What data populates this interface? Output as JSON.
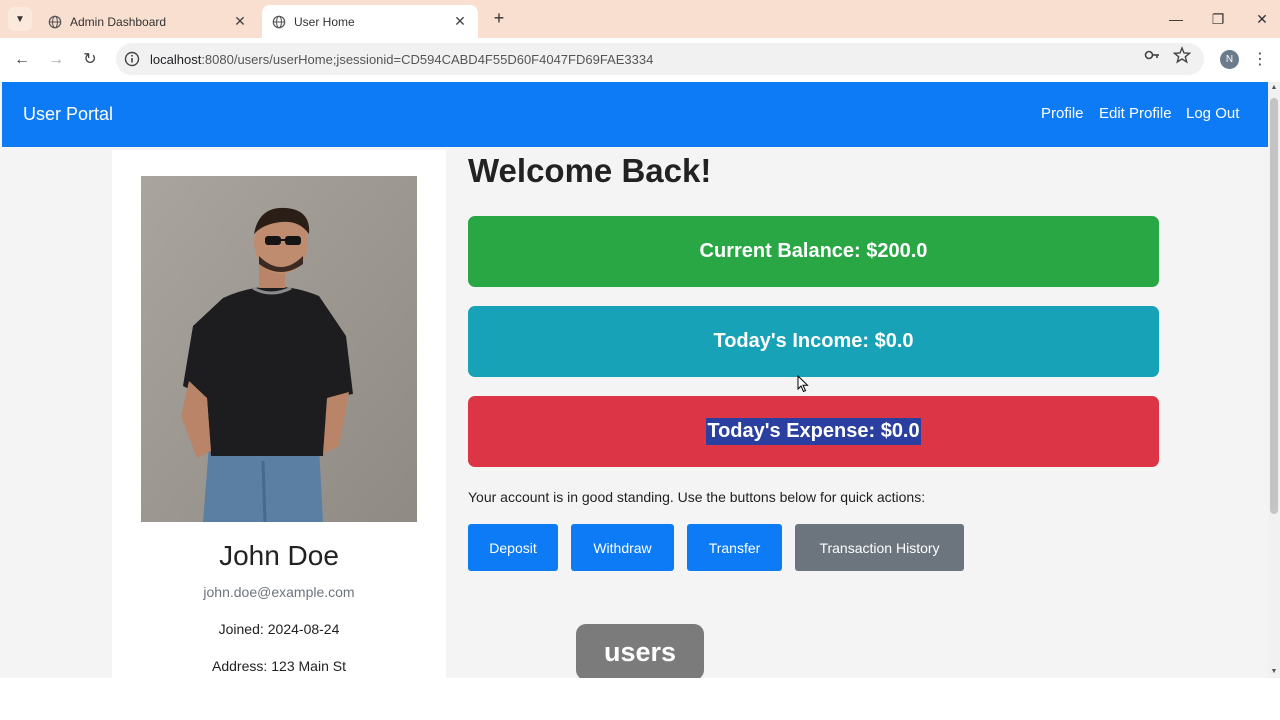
{
  "browser": {
    "tabs": [
      {
        "title": "Admin Dashboard",
        "active": false
      },
      {
        "title": "User Home",
        "active": true
      }
    ],
    "url_host": "localhost",
    "url_rest": ":8080/users/userHome;jsessionid=CD594CABD4F55D60F4047FD69FAE3334",
    "profile_initial": "N"
  },
  "navbar": {
    "brand": "User Portal",
    "links": [
      "Profile",
      "Edit Profile",
      "Log Out"
    ],
    "color": "#0d7bf5"
  },
  "profile": {
    "name": "John Doe",
    "email": "john.doe@example.com",
    "joined_label": "Joined:",
    "joined": "2024-08-24",
    "address_label": "Address:",
    "address": "123 Main St"
  },
  "main": {
    "welcome": "Welcome Back!",
    "balance": "Current Balance: $200.0",
    "income": "Today's Income: $0.0",
    "expense": "Today's Expense: $0.0",
    "standing_text": "Your account is in good standing. Use the buttons below for quick actions:",
    "buttons": {
      "deposit": "Deposit",
      "withdraw": "Withdraw",
      "transfer": "Transfer",
      "history": "Transaction History"
    }
  },
  "colors": {
    "balance": "#2aa745",
    "income": "#18a2b8",
    "expense": "#dc3545",
    "secondary": "#6c757d"
  },
  "caption": "users"
}
